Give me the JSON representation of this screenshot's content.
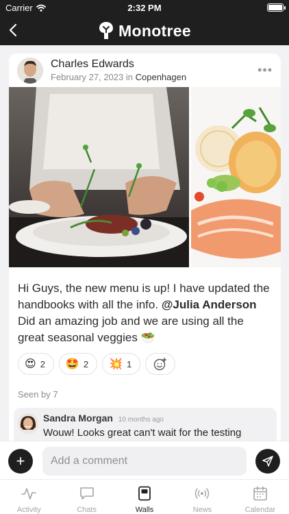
{
  "status_bar": {
    "carrier": "Carrier",
    "time": "2:32 PM"
  },
  "header": {
    "brand": "Monotree"
  },
  "post": {
    "author": "Charles Edwards",
    "date": "February 27, 2023",
    "in_word": "in",
    "location": "Copenhagen",
    "text_before": "Hi Guys, the new menu is up! I have updated the handbooks with all the info. ",
    "mention": "@Julia Anderson",
    "text_after": " Did an amazing job and we are using all the great seasonal veggies 🥗",
    "reactions": [
      {
        "emoji": "😍",
        "count": "2"
      },
      {
        "emoji": "🤩",
        "count": "2"
      },
      {
        "emoji": "💥",
        "count": "1"
      }
    ],
    "seen_by": "Seen by 7"
  },
  "comment": {
    "author": "Sandra Morgan",
    "time": "10 months ago",
    "text": "Wouw! Looks great can't wait for the testing"
  },
  "composer": {
    "placeholder": "Add a comment"
  },
  "tabs": [
    {
      "label": "Activity",
      "icon": "activity-icon"
    },
    {
      "label": "Chats",
      "icon": "chat-icon"
    },
    {
      "label": "Walls",
      "icon": "walls-icon",
      "active": true
    },
    {
      "label": "News",
      "icon": "broadcast-icon"
    },
    {
      "label": "Calendar",
      "icon": "calendar-icon"
    }
  ],
  "colors": {
    "header_bg": "#1f1f1f",
    "page_bg": "#f2f2f4",
    "muted_text": "#8a8a8a",
    "inactive_tab": "#a5a5a5"
  }
}
